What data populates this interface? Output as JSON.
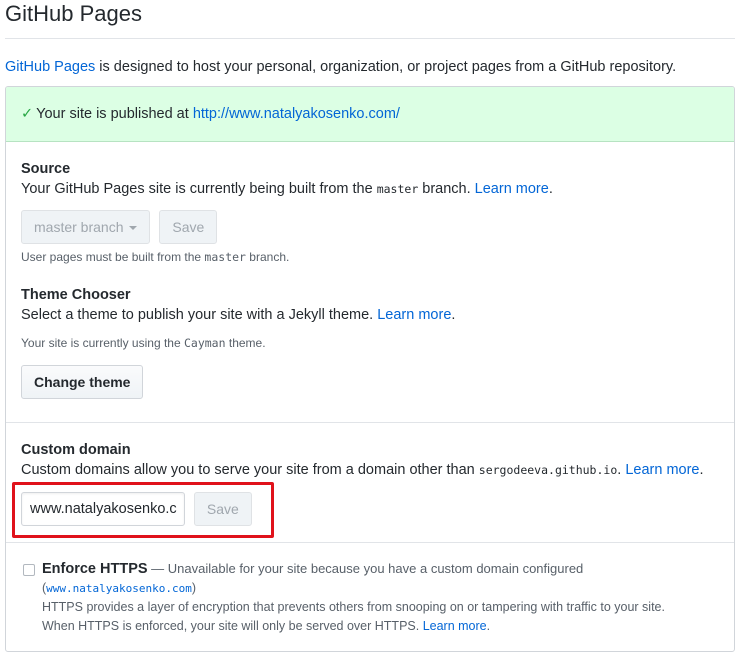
{
  "page": {
    "title": "GitHub Pages",
    "intro_link": "GitHub Pages",
    "intro_text": " is designed to host your personal, organization, or project pages from a GitHub repository."
  },
  "flash": {
    "text": "Your site is published at ",
    "url": "http://www.natalyakosenko.com/"
  },
  "source": {
    "heading": "Source",
    "desc_prefix": "Your GitHub Pages site is currently being built from the ",
    "branch_code": "master",
    "desc_suffix": " branch. ",
    "learn_more": "Learn more",
    "desc_end": ".",
    "branch_select": "master branch",
    "save_label": "Save",
    "note_prefix": "User pages must be built from the ",
    "note_code": "master",
    "note_suffix": " branch."
  },
  "theme": {
    "heading": "Theme Chooser",
    "desc": "Select a theme to publish your site with a Jekyll theme. ",
    "learn_more": "Learn more",
    "desc_end": ".",
    "note_prefix": "Your site is currently using the ",
    "theme_code": "Cayman",
    "note_suffix": " theme.",
    "change_label": "Change theme"
  },
  "domain": {
    "heading": "Custom domain",
    "desc_prefix": "Custom domains allow you to serve your site from a domain other than ",
    "domain_code": "sergodeeva.github.io",
    "desc_suffix": ". ",
    "learn_more": "Learn more",
    "desc_end": ".",
    "input_value": "www.natalyakosenko.c",
    "save_label": "Save"
  },
  "https": {
    "label": "Enforce HTTPS",
    "unavailable": " — Unavailable for your site because you have a custom domain configured",
    "paren_open": "(",
    "domain_code": "www.natalyakosenko.com",
    "paren_close": ")",
    "desc1": "HTTPS provides a layer of encryption that prevents others from snooping on or tampering with traffic to your site.",
    "desc2": "When HTTPS is enforced, your site will only be served over HTTPS. ",
    "learn_more": "Learn more",
    "desc_end": "."
  },
  "colors": {
    "link": "#0366d6",
    "success_bg": "#dcffe4",
    "highlight": "#e0121b"
  }
}
